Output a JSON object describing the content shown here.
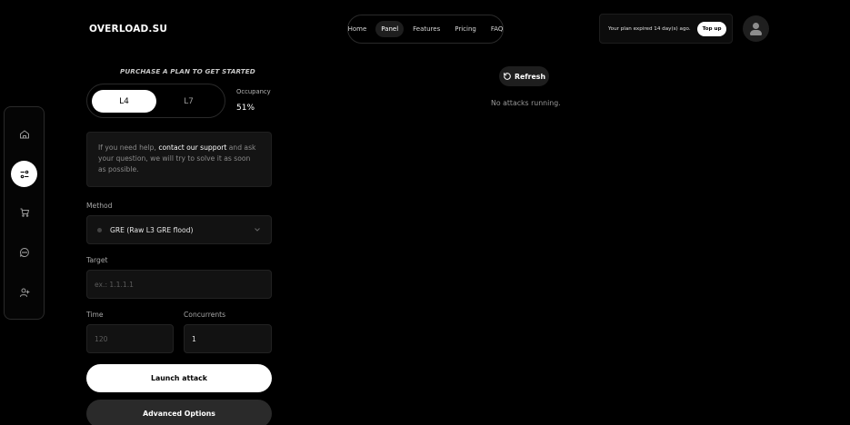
{
  "header": {
    "logo": "OVERLOAD.SU",
    "nav": [
      "Home",
      "Panel",
      "Features",
      "Pricing",
      "FAQ"
    ],
    "active_nav": "Panel",
    "plan_notice": "Your plan expired 14 day(s) ago.",
    "topup_label": "Top up"
  },
  "sidebar": {
    "items": [
      {
        "icon": "home-icon"
      },
      {
        "icon": "panel-sliders-icon",
        "active": true
      },
      {
        "icon": "cart-icon"
      },
      {
        "icon": "chat-icon"
      },
      {
        "icon": "add-user-icon"
      }
    ]
  },
  "panel": {
    "purchase_heading": "PURCHASE A PLAN TO GET STARTED",
    "layers": [
      "L4",
      "L7"
    ],
    "selected_layer": "L4",
    "occupancy_label": "Occupancy",
    "occupancy_value": "51%",
    "help": {
      "prefix": "If you need help, ",
      "link": "contact our support",
      "suffix": " and ask your question, we will try to solve it as soon as possible."
    },
    "method_label": "Method",
    "method_value": "GRE (Raw L3 GRE flood)",
    "target_label": "Target",
    "target_placeholder": "ex.: 1.1.1.1",
    "time_label": "Time",
    "time_placeholder": "120",
    "concurrents_label": "Concurrents",
    "concurrents_value": "1",
    "launch_label": "Launch attack",
    "advanced_label": "Advanced Options"
  },
  "attacks": {
    "refresh_label": "Refresh",
    "empty_text": "No attacks running."
  },
  "colors": {
    "background": "#000000",
    "accent": "#ffffff",
    "card": "#141414"
  }
}
